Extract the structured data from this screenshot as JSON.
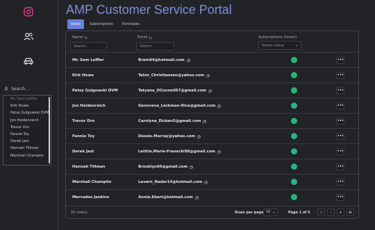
{
  "app": {
    "title": "AMP Customer Service Portal"
  },
  "sidebar": {
    "icons": [
      "instagram-icon",
      "users-icon",
      "car-icon"
    ],
    "search_placeholder": "Search...",
    "list_items": [
      "Mr. Sam Leffler",
      "Kirk Howe",
      "Patsy Gulgowski DVM",
      "Jon Heidenreich",
      "Trevor Orn",
      "Fannie Toy",
      "Derek Jast",
      "Hannah Tillman",
      "Marshall Champlin"
    ]
  },
  "tabs": [
    "Users",
    "Subscriptions",
    "Purchases"
  ],
  "table": {
    "columns": {
      "name": "Name",
      "email": "Email",
      "subscriptions": "Subscriptions (hover)"
    },
    "filters": {
      "name_placeholder": "Search...",
      "email_placeholder": "Search...",
      "status_placeholder": "Select status"
    },
    "rows": [
      {
        "name": "Mr. Sam Leffler",
        "email": "Brain94@hotmail.com"
      },
      {
        "name": "Kirk Howe",
        "email": "Talon_Christiansen@yahoo.com"
      },
      {
        "name": "Patsy Gulgowski DVM",
        "email": "Tatyana_OConnell67@gmail.com"
      },
      {
        "name": "Jon Heidenreich",
        "email": "Genoveva_Leckman-Rice@gmail.com"
      },
      {
        "name": "Trevor Orn",
        "email": "Carolyne_Dicken5@gmail.com"
      },
      {
        "name": "Fannie Toy",
        "email": "Dessie.Murray@yahoo.com"
      },
      {
        "name": "Derek Jast",
        "email": "Letitia.Marie-Franecki98@gmail.com"
      },
      {
        "name": "Hannah Tillman",
        "email": "Brooklyn60@gmail.com"
      },
      {
        "name": "Marshall Champlin",
        "email": "Lavern_Nader14@hotmail.com"
      },
      {
        "name": "Mercedes Jenkins",
        "email": "Annie.Ebert@hotmail.com"
      }
    ],
    "row_action_label": "•••",
    "status_color": "#27b57b"
  },
  "footer": {
    "row_count": "50 row(s).",
    "rows_per_page_label": "Rows per page",
    "rows_per_page_value": "10",
    "page_info": "Page 1 of 5"
  },
  "colors": {
    "accent": "#6a7fdb",
    "title": "#7f8fdd",
    "status_active": "#27b57b",
    "background": "#222327"
  }
}
